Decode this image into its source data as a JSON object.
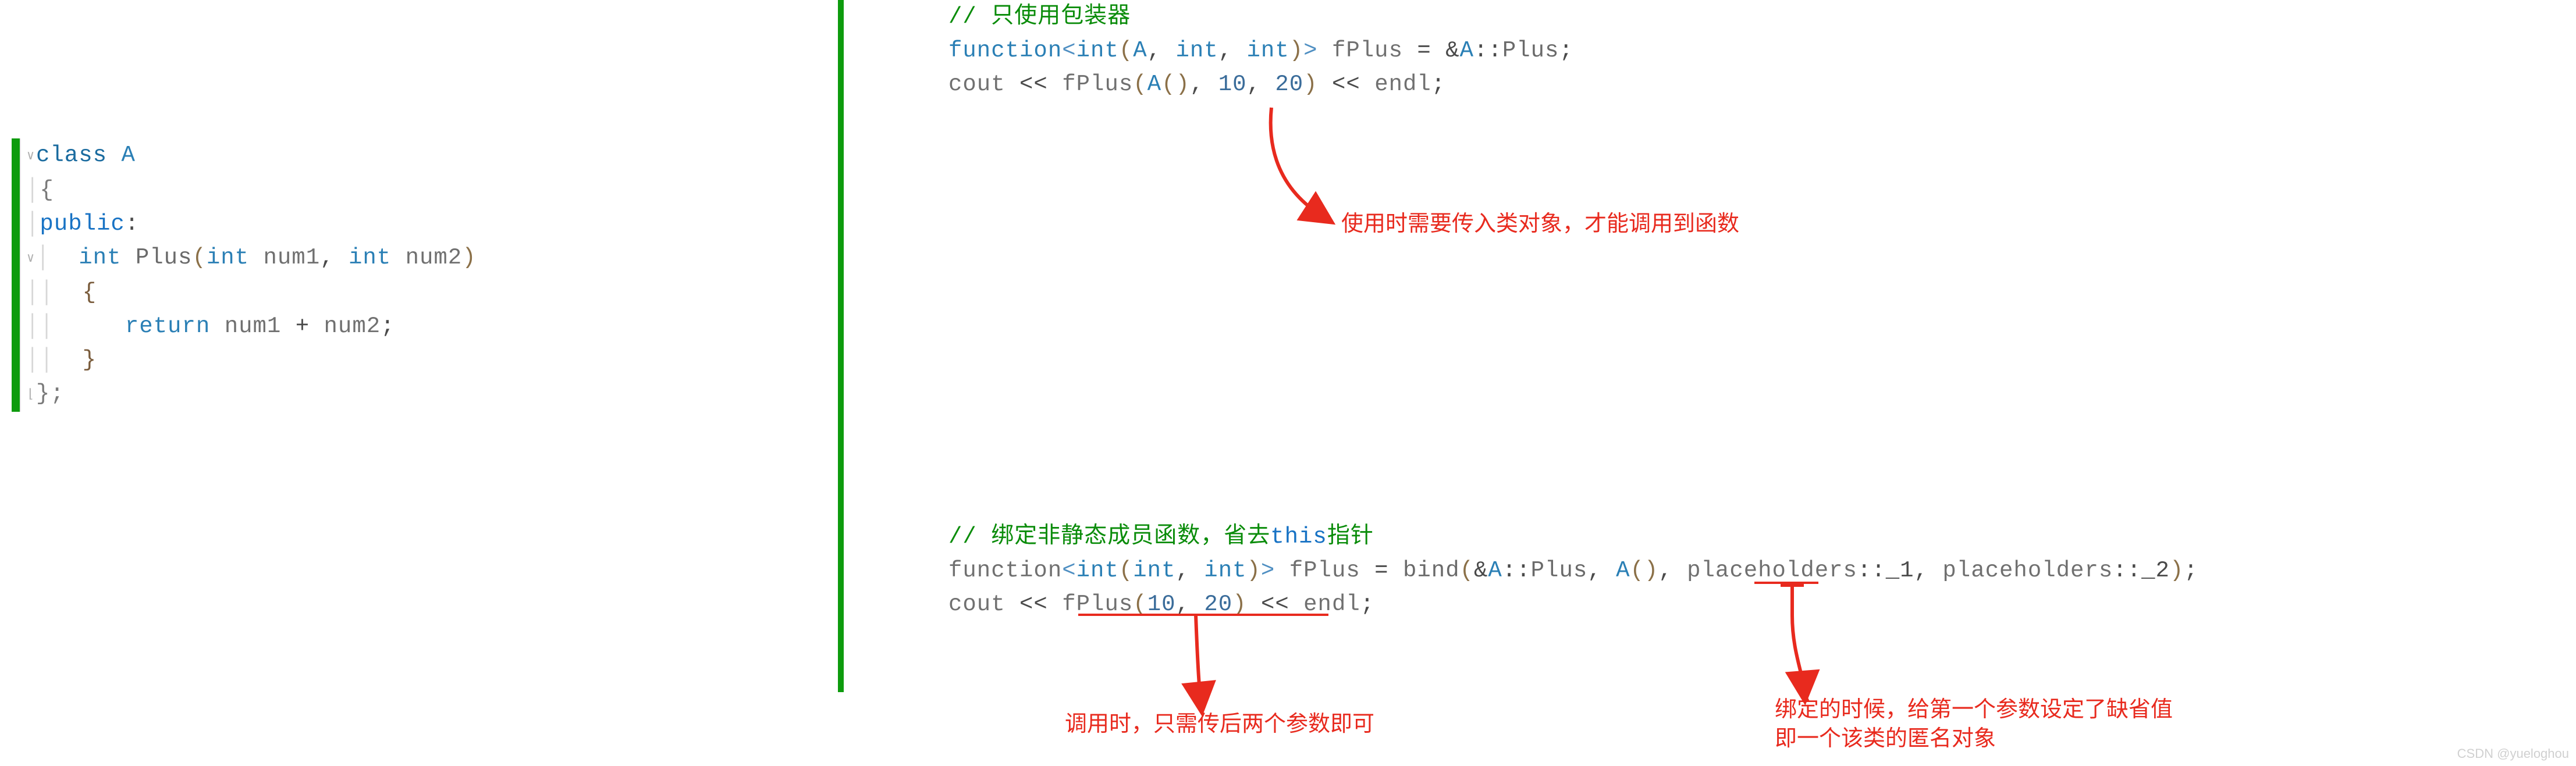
{
  "left_code": {
    "l1_class": "class",
    "l1_name": "A",
    "l2": "{",
    "l3": "public",
    "l3b": ":",
    "l4_int": "int",
    "l4_fn": "Plus",
    "l4_p1t": "int",
    "l4_p1n": "num1",
    "l4_p2t": "int",
    "l4_p2n": "num2",
    "l5": "{",
    "l6_ret": "return",
    "l6_a": "num1",
    "l6_plus": "+",
    "l6_b": "num2",
    "l6_semi": ";",
    "l7": "}",
    "l8": "};"
  },
  "right_block1": {
    "c1": "// 只使用包装器",
    "l2_function": "function",
    "l2_int": "int",
    "l2_A": "A",
    "l2_int2": "int",
    "l2_int3": "int",
    "l2_name": "fPlus",
    "l2_eq": "=",
    "l2_amp": "&",
    "l2_Aq": "A",
    "l2_sc": "::",
    "l2_Plus": "Plus",
    "l2_semi": ";",
    "l3_cout": "cout",
    "l3_ll": "<<",
    "l3_fPlus": "fPlus",
    "l3_A": "A",
    "l3_p1": "10",
    "l3_p2": "20",
    "l3_ll2": "<<",
    "l3_endl": "endl",
    "l3_semi": ";"
  },
  "right_block2": {
    "c1a": "// 绑定非静态成员函数，省去",
    "c1b": "this",
    "c1c": "指针",
    "l2_function": "function",
    "l2_int": "int",
    "l2_int2": "int",
    "l2_int3": "int",
    "l2_name": "fPlus",
    "l2_eq": "=",
    "l2_bind": "bind",
    "l2_amp": "&",
    "l2_Aq": "A",
    "l2_sc": "::",
    "l2_Plus": "Plus",
    "l2_Aobj": "A",
    "l2_ph": "placeholders",
    "l2_p1": "::_1",
    "l2_p2": "::_2",
    "l2_semi": ";",
    "l3_cout": "cout",
    "l3_ll": "<<",
    "l3_fPlus": "fPlus",
    "l3_p1": "10",
    "l3_p2": "20",
    "l3_ll2": "<<",
    "l3_endl": "endl",
    "l3_semi": ";"
  },
  "annotations": {
    "a1": "使用时需要传入类对象，才能调用到函数",
    "a2": "调用时，只需传后两个参数即可",
    "a3_l1": "绑定的时候，给第一个参数设定了缺省值",
    "a3_l2": "即一个该类的匿名对象"
  },
  "watermark": "CSDN @yueloghou"
}
